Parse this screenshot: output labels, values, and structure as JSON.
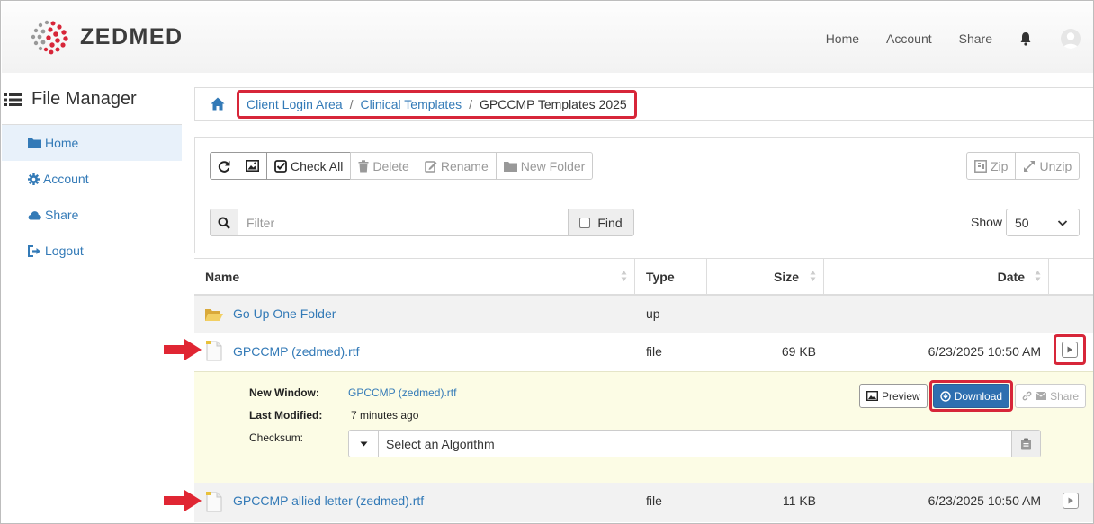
{
  "brand": {
    "name": "ZEDMED"
  },
  "topnav": {
    "home": "Home",
    "account": "Account",
    "share": "Share"
  },
  "sidebar": {
    "title": "File Manager",
    "items": [
      {
        "label": "Home",
        "icon": "folder-icon"
      },
      {
        "label": "Account",
        "icon": "gear-icon"
      },
      {
        "label": "Share",
        "icon": "cloud-icon"
      },
      {
        "label": "Logout",
        "icon": "logout-icon"
      }
    ]
  },
  "breadcrumb": {
    "items": [
      "Client Login Area",
      "Clinical Templates"
    ],
    "current": "GPCCMP Templates 2025",
    "separator": "/"
  },
  "toolbar": {
    "check_all": "Check All",
    "delete": "Delete",
    "rename": "Rename",
    "new_folder": "New Folder",
    "zip": "Zip",
    "unzip": "Unzip"
  },
  "filter": {
    "placeholder": "Filter",
    "find": "Find"
  },
  "show": {
    "label": "Show",
    "value": "50"
  },
  "table": {
    "headers": {
      "name": "Name",
      "type": "Type",
      "size": "Size",
      "date": "Date"
    },
    "rows": [
      {
        "name": "Go Up One Folder",
        "type": "up",
        "size": "",
        "date": ""
      },
      {
        "name": "GPCCMP (zedmed).rtf",
        "type": "file",
        "size": "69 KB",
        "date": "6/23/2025 10:50 AM"
      },
      {
        "name": "GPCCMP allied letter (zedmed).rtf",
        "type": "file",
        "size": "11 KB",
        "date": "6/23/2025 10:50 AM"
      }
    ]
  },
  "details": {
    "new_window_label": "New Window:",
    "new_window_value": "GPCCMP (zedmed).rtf",
    "last_modified_label": "Last Modified:",
    "last_modified_value": "7 minutes ago",
    "checksum_label": "Checksum:",
    "algorithm_placeholder": "Select an Algorithm",
    "preview": "Preview",
    "download": "Download",
    "share": "Share"
  },
  "colors": {
    "link": "#337ab7",
    "highlight_red": "#d72639",
    "download_button": "#2e6fb0",
    "details_bg": "#fcfce5"
  }
}
